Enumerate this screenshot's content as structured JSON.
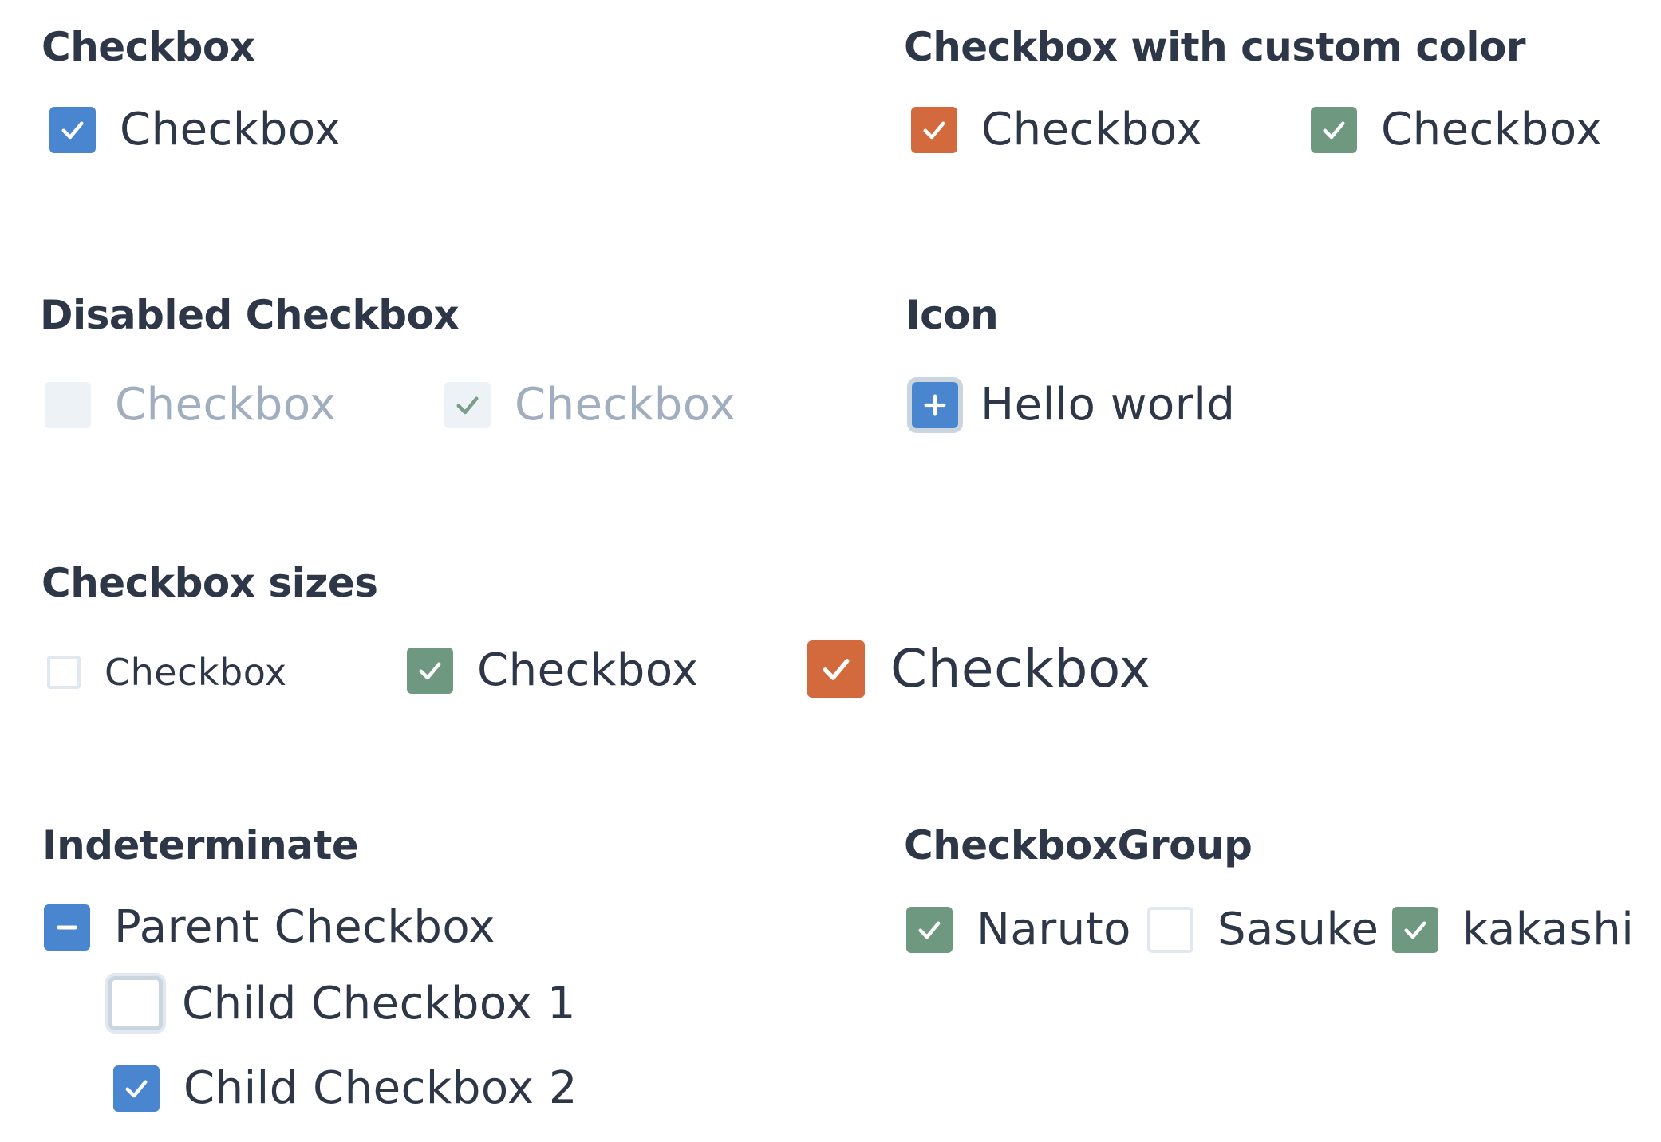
{
  "sections": {
    "basic": {
      "title": "Checkbox",
      "item_label": "Checkbox"
    },
    "custom_color": {
      "title": "Checkbox with custom color",
      "items": [
        {
          "label": "Checkbox",
          "color": "#d26a3e",
          "checked": true
        },
        {
          "label": "Checkbox",
          "color": "#6e9980",
          "checked": true
        }
      ]
    },
    "disabled": {
      "title": "Disabled Checkbox",
      "items": [
        {
          "label": "Checkbox",
          "checked": false
        },
        {
          "label": "Checkbox",
          "checked": true
        }
      ]
    },
    "icon": {
      "title": "Icon",
      "item_label": "Hello world",
      "icon": "plus-icon"
    },
    "sizes": {
      "title": "Checkbox sizes",
      "items": [
        {
          "label": "Checkbox",
          "size": "sm",
          "checked": false
        },
        {
          "label": "Checkbox",
          "size": "md",
          "checked": true,
          "color": "#6e9980"
        },
        {
          "label": "Checkbox",
          "size": "lg",
          "checked": true,
          "color": "#d26a3e"
        }
      ]
    },
    "indeterminate": {
      "title": "Indeterminate",
      "parent_label": "Parent Checkbox",
      "children": [
        {
          "label": "Child Checkbox 1",
          "checked": false
        },
        {
          "label": "Child Checkbox 2",
          "checked": true
        }
      ]
    },
    "group": {
      "title": "CheckboxGroup",
      "items": [
        {
          "label": "Naruto",
          "checked": true
        },
        {
          "label": "Sasuke",
          "checked": false
        },
        {
          "label": "kakashi",
          "checked": true
        }
      ]
    }
  },
  "colors": {
    "blue": "#4a86cf",
    "orange": "#d26a3e",
    "green": "#6e9980",
    "text": "#2d3748",
    "disabled_text": "#a0aec0"
  }
}
